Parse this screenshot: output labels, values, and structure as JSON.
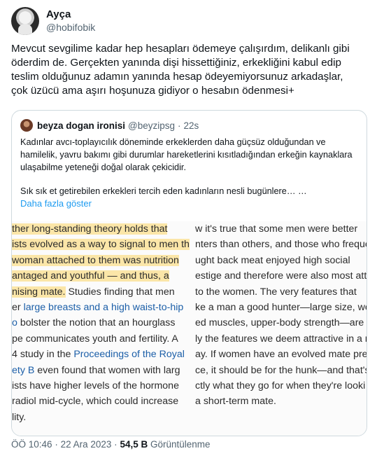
{
  "author": {
    "display_name": "Ayça",
    "handle": "@hobifobik"
  },
  "tweet_text": "Mevcut sevgilime kadar hep hesapları ödemeye çalışırdım, delikanlı gibi öderdim de. Gerçekten yanında dişi hissettiğiniz, erkekliğini kabul edip teslim olduğunuz adamın yanında hesap ödeyemiyorsunuz arkadaşlar, çok üzücü ama aşırı hoşunuza gidiyor o hesabın ödenmesi+",
  "quote": {
    "display_name": "beyza dogan ironisi",
    "handle": "@beyzipsg",
    "dot": "·",
    "time": "22s",
    "text_1": "Kadınlar avcı-toplayıcılık döneminde erkeklerden daha güçsüz olduğundan ve hamilelik, yavru bakımı gibi durumlar hareketlerini kısıtladığından erkeğin kaynaklara ulaşabilme yeteneği doğal olarak çekicidir.",
    "text_2": "Sık sık et getirebilen erkekleri tercih eden kadınların nesli bugünlere…  …",
    "show_more": "Daha fazla göster",
    "image": {
      "left_lines": [
        {
          "parts": [
            {
              "t": "ther long-standing theory holds that",
              "hl": true
            }
          ]
        },
        {
          "parts": [
            {
              "t": "ists evolved as a way to signal to men th",
              "hl": true
            }
          ]
        },
        {
          "parts": [
            {
              "t": "woman attached to them was nutrition",
              "hl": true
            }
          ]
        },
        {
          "parts": [
            {
              "t": "antaged and youthful — and thus, a",
              "hl": true
            }
          ]
        },
        {
          "parts": [
            {
              "t": "nising mate.",
              "hl": true
            },
            {
              "t": " Studies finding that men"
            }
          ]
        },
        {
          "parts": [
            {
              "t": "er "
            },
            {
              "t": "large breasts and a high waist-to-hip",
              "link": true
            }
          ]
        },
        {
          "parts": [
            {
              "t": "o",
              "link": true
            },
            {
              "t": " bolster the notion that an hourglass"
            }
          ]
        },
        {
          "parts": [
            {
              "t": "pe communicates youth and fertility. A"
            }
          ]
        },
        {
          "parts": [
            {
              "t": "4 study in the "
            },
            {
              "t": "Proceedings of the Royal",
              "link": true
            }
          ]
        },
        {
          "parts": [
            {
              "t": "ety B",
              "link": true
            },
            {
              "t": " even found that women with larg"
            }
          ]
        },
        {
          "parts": [
            {
              "t": "ists have higher levels of the hormone"
            }
          ]
        },
        {
          "parts": [
            {
              "t": "radiol mid-cycle, which could increase"
            }
          ]
        },
        {
          "parts": [
            {
              "t": "lity."
            }
          ]
        }
      ],
      "right_lines": [
        "w it's true that some men were better",
        "nters than others, and those who frequen",
        "ught back meat enjoyed high social",
        "estige and therefore were also most attra",
        "to the women. The very features that",
        "ke a man a good hunter—large size, wel",
        "ed muscles, upper-body strength—are e",
        "ly the features we deem attractive in a m",
        "ay. If women have an evolved mate pref",
        "ce, it should be for the hunk—and that's",
        "ctly what they go for when they're looki",
        "a short-term mate."
      ]
    }
  },
  "meta": {
    "time": "ÖÖ 10:46",
    "sep_1": "·",
    "date": "22 Ara 2023",
    "sep_2": "·",
    "views_count": "54,5 B",
    "views_label": "Görüntülenme"
  }
}
